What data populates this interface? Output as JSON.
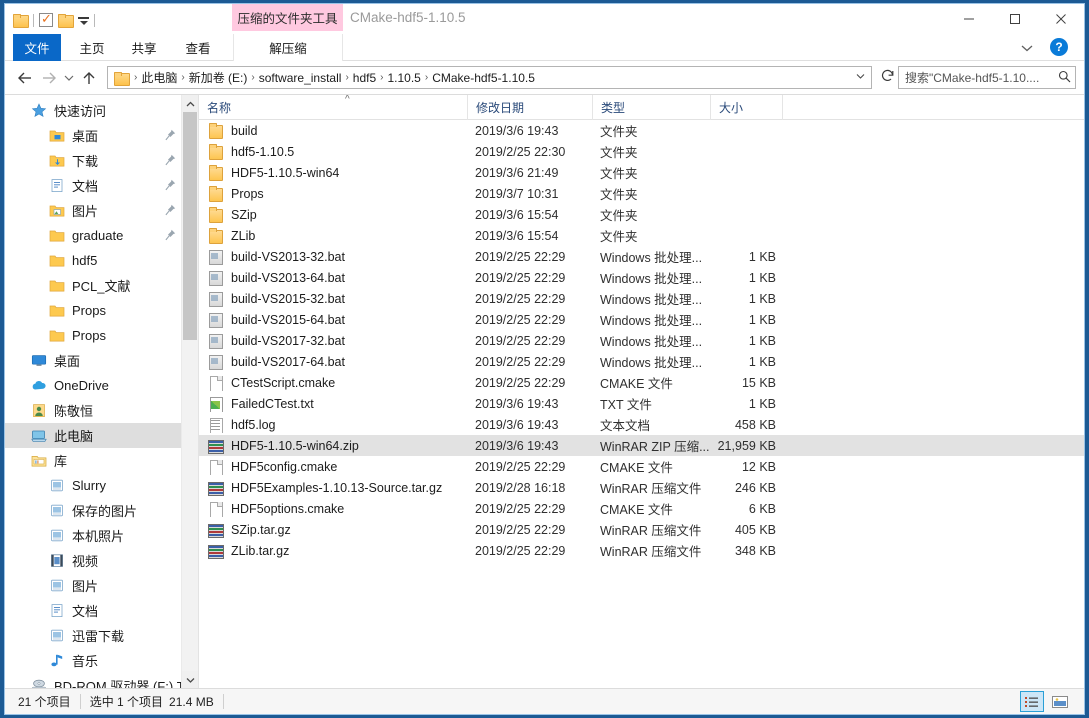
{
  "window": {
    "title": "CMake-hdf5-1.10.5",
    "contextual_tab_group": "压缩的文件夹工具",
    "minimize_label": "最小化",
    "maximize_label": "最大化",
    "close_label": "关闭",
    "help_label": "?"
  },
  "quick_access_toolbar": {
    "items": [
      {
        "name": "folder-icon",
        "label": "属性文件夹"
      },
      {
        "name": "properties-icon",
        "label": "属性"
      },
      {
        "name": "new-folder-icon",
        "label": "新建文件夹"
      },
      {
        "name": "customize-dropdown",
        "label": "自定义快速访问工具栏"
      }
    ]
  },
  "ribbon": {
    "tabs": [
      {
        "id": "file",
        "label": "文件",
        "active": true
      },
      {
        "id": "home",
        "label": "主页",
        "active": false
      },
      {
        "id": "share",
        "label": "共享",
        "active": false
      },
      {
        "id": "view",
        "label": "查看",
        "active": false
      },
      {
        "id": "extract",
        "label": "解压缩",
        "active": false,
        "contextual": true
      }
    ],
    "collapse_label": "折叠功能区",
    "help_label": "帮助"
  },
  "navigation": {
    "back_label": "后退",
    "forward_label": "前进",
    "recent_label": "最近浏览的位置",
    "up_label": "上移到",
    "refresh_label": "刷新",
    "dropdown_label": "展开"
  },
  "breadcrumb": {
    "items": [
      "此电脑",
      "新加卷 (E:)",
      "software_install",
      "hdf5",
      "1.10.5",
      "CMake-hdf5-1.10.5"
    ],
    "separator": "›"
  },
  "search": {
    "placeholder": "搜索\"CMake-hdf5-1.10....",
    "icon": "search-icon"
  },
  "sidebar": {
    "items": [
      {
        "label": "快速访问",
        "icon": "star-icon",
        "indent": 0,
        "pinned": false,
        "selected": false
      },
      {
        "label": "桌面",
        "icon": "desktop-folder-icon",
        "indent": 1,
        "pinned": true,
        "selected": false
      },
      {
        "label": "下载",
        "icon": "downloads-folder-icon",
        "indent": 1,
        "pinned": true,
        "selected": false
      },
      {
        "label": "文档",
        "icon": "documents-folder-icon",
        "indent": 1,
        "pinned": true,
        "selected": false
      },
      {
        "label": "图片",
        "icon": "pictures-folder-icon",
        "indent": 1,
        "pinned": true,
        "selected": false
      },
      {
        "label": "graduate",
        "icon": "folder-icon",
        "indent": 1,
        "pinned": true,
        "selected": false
      },
      {
        "label": "hdf5",
        "icon": "folder-icon",
        "indent": 1,
        "pinned": false,
        "selected": false
      },
      {
        "label": "PCL_文献",
        "icon": "folder-icon",
        "indent": 1,
        "pinned": false,
        "selected": false
      },
      {
        "label": "Props",
        "icon": "folder-icon",
        "indent": 1,
        "pinned": false,
        "selected": false
      },
      {
        "label": "Props",
        "icon": "folder-icon",
        "indent": 1,
        "pinned": false,
        "selected": false
      },
      {
        "label": "桌面",
        "icon": "monitor-icon",
        "indent": 0,
        "pinned": false,
        "selected": false
      },
      {
        "label": "OneDrive",
        "icon": "cloud-icon",
        "indent": 0,
        "pinned": false,
        "selected": false
      },
      {
        "label": "陈敬恒",
        "icon": "user-icon",
        "indent": 0,
        "pinned": false,
        "selected": false
      },
      {
        "label": "此电脑",
        "icon": "this-pc-icon",
        "indent": 0,
        "pinned": false,
        "selected": true
      },
      {
        "label": "库",
        "icon": "library-icon",
        "indent": 0,
        "pinned": false,
        "selected": false
      },
      {
        "label": "Slurry",
        "icon": "library-item-icon",
        "indent": 1,
        "pinned": false,
        "selected": false
      },
      {
        "label": "保存的图片",
        "icon": "library-item-icon",
        "indent": 1,
        "pinned": false,
        "selected": false
      },
      {
        "label": "本机照片",
        "icon": "library-item-icon",
        "indent": 1,
        "pinned": false,
        "selected": false
      },
      {
        "label": "视频",
        "icon": "video-library-icon",
        "indent": 1,
        "pinned": false,
        "selected": false
      },
      {
        "label": "图片",
        "icon": "library-item-icon",
        "indent": 1,
        "pinned": false,
        "selected": false
      },
      {
        "label": "文档",
        "icon": "documents-library-icon",
        "indent": 1,
        "pinned": false,
        "selected": false
      },
      {
        "label": "迅雷下载",
        "icon": "library-item-icon",
        "indent": 1,
        "pinned": false,
        "selected": false
      },
      {
        "label": "音乐",
        "icon": "music-library-icon",
        "indent": 1,
        "pinned": false,
        "selected": false
      },
      {
        "label": "BD-ROM 驱动器 (F:) T",
        "icon": "optical-drive-icon",
        "indent": 0,
        "pinned": false,
        "selected": false
      }
    ]
  },
  "filelist": {
    "columns": [
      {
        "id": "name",
        "label": "名称",
        "sorted": "asc"
      },
      {
        "id": "date",
        "label": "修改日期"
      },
      {
        "id": "type",
        "label": "类型"
      },
      {
        "id": "size",
        "label": "大小"
      }
    ],
    "sort_indicator": "^",
    "rows": [
      {
        "name": "build",
        "date": "2019/3/6 19:43",
        "type": "文件夹",
        "size": "",
        "icon": "folder-icon",
        "selected": false
      },
      {
        "name": "hdf5-1.10.5",
        "date": "2019/2/25 22:30",
        "type": "文件夹",
        "size": "",
        "icon": "folder-icon",
        "selected": false
      },
      {
        "name": "HDF5-1.10.5-win64",
        "date": "2019/3/6 21:49",
        "type": "文件夹",
        "size": "",
        "icon": "folder-icon",
        "selected": false
      },
      {
        "name": "Props",
        "date": "2019/3/7 10:31",
        "type": "文件夹",
        "size": "",
        "icon": "folder-icon",
        "selected": false
      },
      {
        "name": "SZip",
        "date": "2019/3/6 15:54",
        "type": "文件夹",
        "size": "",
        "icon": "folder-icon",
        "selected": false
      },
      {
        "name": "ZLib",
        "date": "2019/3/6 15:54",
        "type": "文件夹",
        "size": "",
        "icon": "folder-icon",
        "selected": false
      },
      {
        "name": "build-VS2013-32.bat",
        "date": "2019/2/25 22:29",
        "type": "Windows 批处理...",
        "size": "1 KB",
        "icon": "bat-icon",
        "selected": false
      },
      {
        "name": "build-VS2013-64.bat",
        "date": "2019/2/25 22:29",
        "type": "Windows 批处理...",
        "size": "1 KB",
        "icon": "bat-icon",
        "selected": false
      },
      {
        "name": "build-VS2015-32.bat",
        "date": "2019/2/25 22:29",
        "type": "Windows 批处理...",
        "size": "1 KB",
        "icon": "bat-icon",
        "selected": false
      },
      {
        "name": "build-VS2015-64.bat",
        "date": "2019/2/25 22:29",
        "type": "Windows 批处理...",
        "size": "1 KB",
        "icon": "bat-icon",
        "selected": false
      },
      {
        "name": "build-VS2017-32.bat",
        "date": "2019/2/25 22:29",
        "type": "Windows 批处理...",
        "size": "1 KB",
        "icon": "bat-icon",
        "selected": false
      },
      {
        "name": "build-VS2017-64.bat",
        "date": "2019/2/25 22:29",
        "type": "Windows 批处理...",
        "size": "1 KB",
        "icon": "bat-icon",
        "selected": false
      },
      {
        "name": "CTestScript.cmake",
        "date": "2019/2/25 22:29",
        "type": "CMAKE 文件",
        "size": "15 KB",
        "icon": "doc-icon",
        "selected": false
      },
      {
        "name": "FailedCTest.txt",
        "date": "2019/3/6 19:43",
        "type": "TXT 文件",
        "size": "1 KB",
        "icon": "chart-doc-icon",
        "selected": false
      },
      {
        "name": "hdf5.log",
        "date": "2019/3/6 19:43",
        "type": "文本文档",
        "size": "458 KB",
        "icon": "text-doc-icon",
        "selected": false
      },
      {
        "name": "HDF5-1.10.5-win64.zip",
        "date": "2019/3/6 19:43",
        "type": "WinRAR ZIP 压缩...",
        "size": "21,959 KB",
        "icon": "winrar-icon",
        "selected": true
      },
      {
        "name": "HDF5config.cmake",
        "date": "2019/2/25 22:29",
        "type": "CMAKE 文件",
        "size": "12 KB",
        "icon": "doc-icon",
        "selected": false
      },
      {
        "name": "HDF5Examples-1.10.13-Source.tar.gz",
        "date": "2019/2/28 16:18",
        "type": "WinRAR 压缩文件",
        "size": "246 KB",
        "icon": "winrar-icon",
        "selected": false
      },
      {
        "name": "HDF5options.cmake",
        "date": "2019/2/25 22:29",
        "type": "CMAKE 文件",
        "size": "6 KB",
        "icon": "doc-icon",
        "selected": false
      },
      {
        "name": "SZip.tar.gz",
        "date": "2019/2/25 22:29",
        "type": "WinRAR 压缩文件",
        "size": "405 KB",
        "icon": "winrar-icon",
        "selected": false
      },
      {
        "name": "ZLib.tar.gz",
        "date": "2019/2/25 22:29",
        "type": "WinRAR 压缩文件",
        "size": "348 KB",
        "icon": "winrar-icon",
        "selected": false
      }
    ]
  },
  "statusbar": {
    "item_count": "21 个项目",
    "selection": "选中 1 个项目",
    "selection_size": "21.4 MB",
    "details_view_label": "详细信息",
    "large_icons_view_label": "大图标"
  },
  "colors": {
    "accent": "#0a68c8",
    "contextual_tab": "#ffc9e0",
    "selection": "#e2e2e2",
    "window_border": "#1c5a94",
    "column_header_text": "#2a4a7a"
  }
}
